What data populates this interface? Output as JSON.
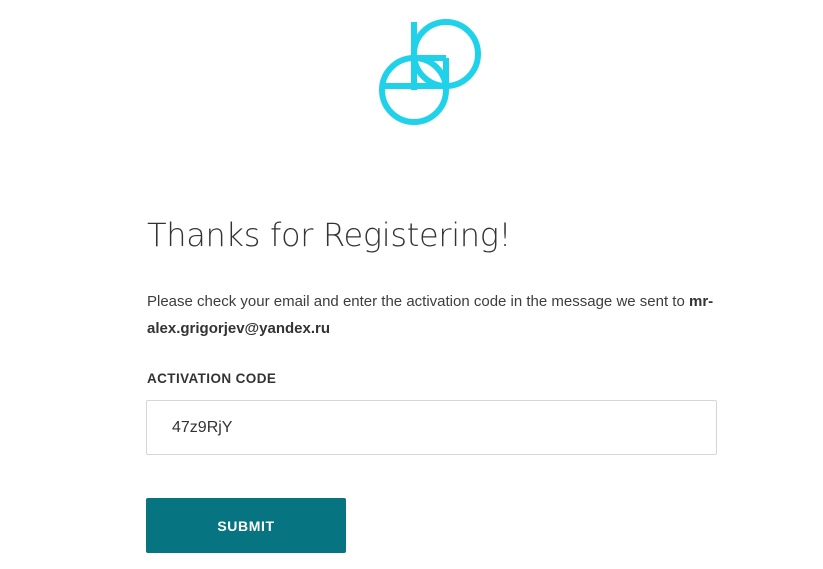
{
  "logo": {
    "icon": "gemini-logo-icon",
    "color": "#1fd2ea"
  },
  "heading": "Thanks for Registering!",
  "message": {
    "text_before": "Please check your email and enter the activation code in the message we sent to ",
    "email": "mr-alex.grigorjev@yandex.ru"
  },
  "activation": {
    "label": "ACTIVATION CODE",
    "value": "47z9RjY"
  },
  "submit_button": {
    "label": "SUBMIT",
    "color": "#077482"
  }
}
